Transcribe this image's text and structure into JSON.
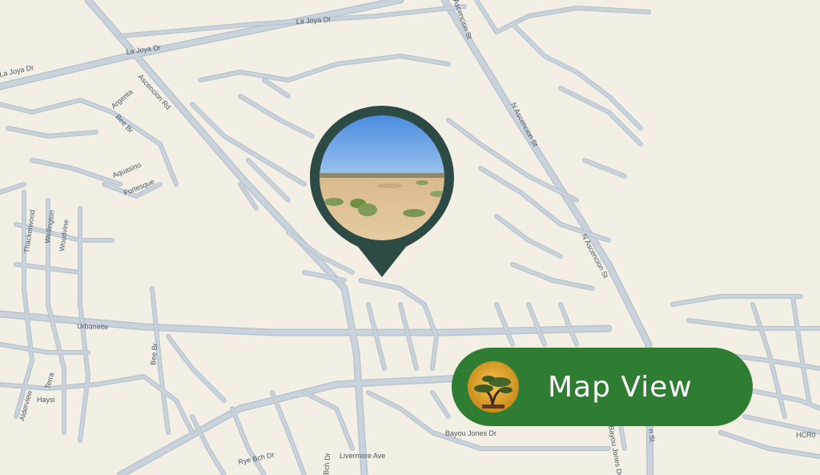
{
  "map": {
    "street_labels": [
      "La Joya Dr",
      "La Joya Dr",
      "La Joya Dr",
      "Ascencion St",
      "Ascencion Rd",
      "Argenta",
      "Bee Br",
      "Aquasino",
      "Fortesque",
      "N Ascencion St",
      "N Ascencion St",
      "Thackerwood",
      "Wellington",
      "Woodvine",
      "Urbaneite",
      "Bee Br",
      "Terra",
      "Haysi",
      "Alderview",
      "Rye Bch Dr",
      "Bch Dr",
      "Livermore Ave",
      "Bayou Jones Dr",
      "Bayou Jones Dr",
      "n St",
      "HCR0"
    ]
  },
  "pin": {
    "fill_color": "#2d4a45",
    "icon": "location-pin-icon",
    "photo": "desert-lot-photo"
  },
  "button": {
    "label": "Map View",
    "background": "#2e7d32",
    "logo": "bonsai-tree-logo"
  }
}
